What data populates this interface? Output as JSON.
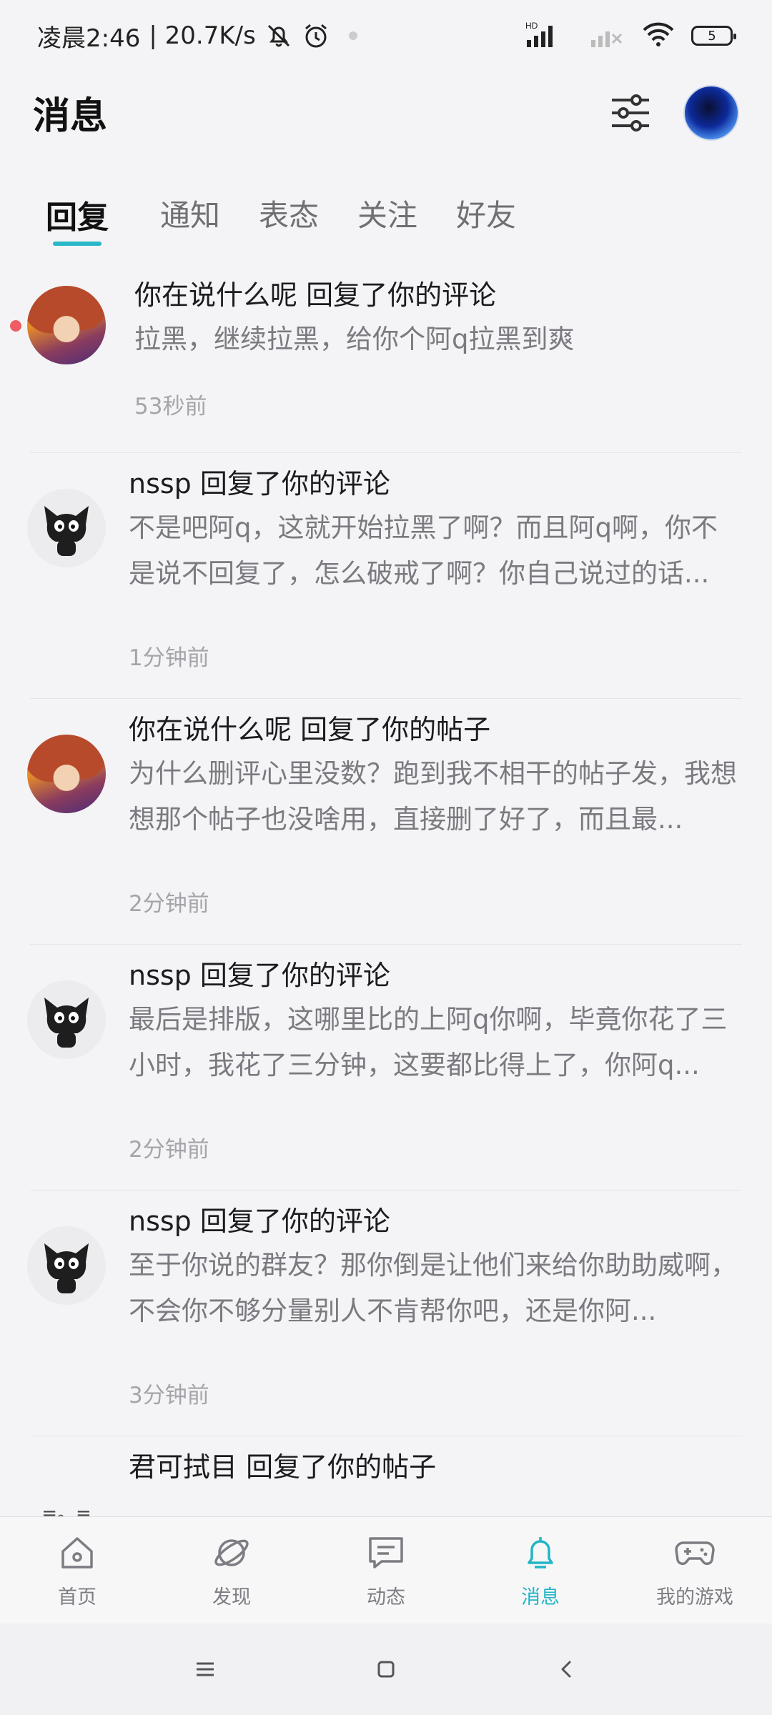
{
  "status_bar": {
    "time": "凌晨2:46",
    "speed": "| 20.7K/s",
    "battery": "5",
    "hd_label": "HD"
  },
  "header": {
    "title": "消息"
  },
  "tabs": [
    {
      "label": "回复",
      "active": true
    },
    {
      "label": "通知",
      "active": false
    },
    {
      "label": "表态",
      "active": false
    },
    {
      "label": "关注",
      "active": false
    },
    {
      "label": "好友",
      "active": false
    }
  ],
  "messages": [
    {
      "avatar": "anime-avatar",
      "title": "你在说什么呢 回复了你的评论",
      "body": "拉黑，继续拉黑，给你个阿q拉黑到爽",
      "time": "53秒前",
      "unread": true
    },
    {
      "avatar": "cat-avatar",
      "title": "nssp 回复了你的评论",
      "body": "不是吧阿q，这就开始拉黑了啊？而且阿q啊，你不是说不回复了，怎么破戒了啊？你自己说过的话...",
      "time": "1分钟前",
      "unread": false
    },
    {
      "avatar": "anime-avatar",
      "title": "你在说什么呢 回复了你的帖子",
      "body": "为什么删评心里没数？跑到我不相干的帖子发，我想想那个帖子也没啥用，直接删了好了，而且最...",
      "time": "2分钟前",
      "unread": false
    },
    {
      "avatar": "cat-avatar",
      "title": "nssp 回复了你的评论",
      "body": "最后是排版，这哪里比的上阿q你啊，毕竟你花了三小时，我花了三分钟，这要都比得上了，你阿q...",
      "time": "2分钟前",
      "unread": false
    },
    {
      "avatar": "cat-avatar",
      "title": "nssp 回复了你的评论",
      "body": "至于你说的群友？那你倒是让他们来给你助助威啊，不会你不够分量别人不肯帮你吧，还是你阿...",
      "time": "3分钟前",
      "unread": false
    },
    {
      "avatar": "text-avatar",
      "avatar_text": "=。=",
      "title": "君可拭目 回复了你的帖子",
      "body": "",
      "time": "",
      "unread": false
    }
  ],
  "bottom_nav": [
    {
      "label": "首页",
      "icon": "home-icon",
      "active": false
    },
    {
      "label": "发现",
      "icon": "planet-icon",
      "active": false
    },
    {
      "label": "动态",
      "icon": "message-square-icon",
      "active": false
    },
    {
      "label": "消息",
      "icon": "bell-icon",
      "active": true
    },
    {
      "label": "我的游戏",
      "icon": "gamepad-icon",
      "active": false
    }
  ],
  "colors": {
    "accent": "#23b5c6",
    "unread_dot": "#f05c63",
    "background": "#f4f4f6"
  }
}
